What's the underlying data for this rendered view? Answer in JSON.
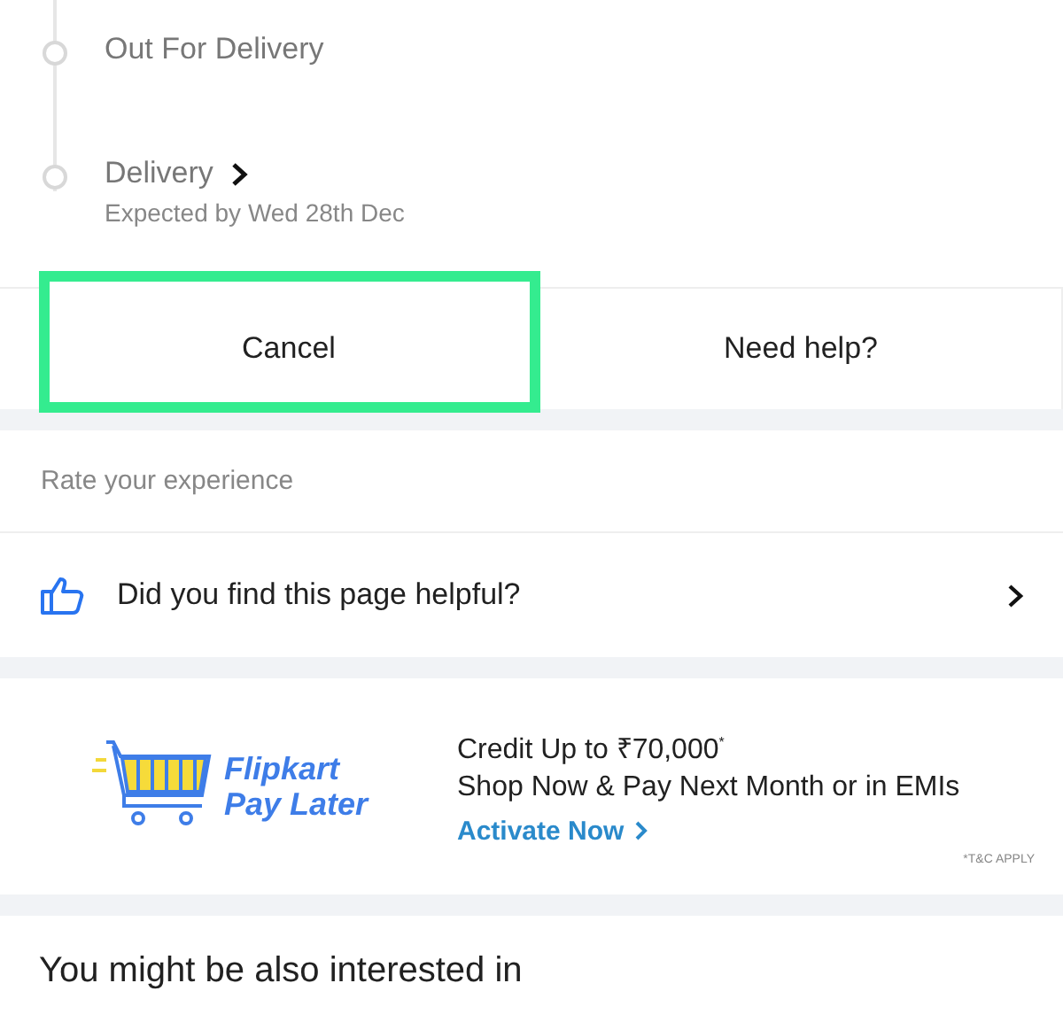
{
  "timeline": [
    {
      "label": "Out For Delivery",
      "has_arrow": false
    },
    {
      "label": "Delivery",
      "has_arrow": true,
      "sub": "Expected by Wed 28th Dec"
    }
  ],
  "actions": [
    {
      "label": "Cancel",
      "highlighted": true
    },
    {
      "label": "Need help?",
      "highlighted": false
    }
  ],
  "rating": {
    "heading": "Rate your experience",
    "question": "Did you find this page helpful?"
  },
  "banner": {
    "brand_line_1": "Flipkart",
    "brand_line_2": "Pay Later",
    "headline": "Credit Up to ₹70,000$^{*}$",
    "subline": "Shop Now & Pay Next Month or in EMIs",
    "link": "Activate Now",
    "terms": "*T&C APPLY"
  },
  "recommendations": {
    "heading": "You might be also interested in"
  }
}
